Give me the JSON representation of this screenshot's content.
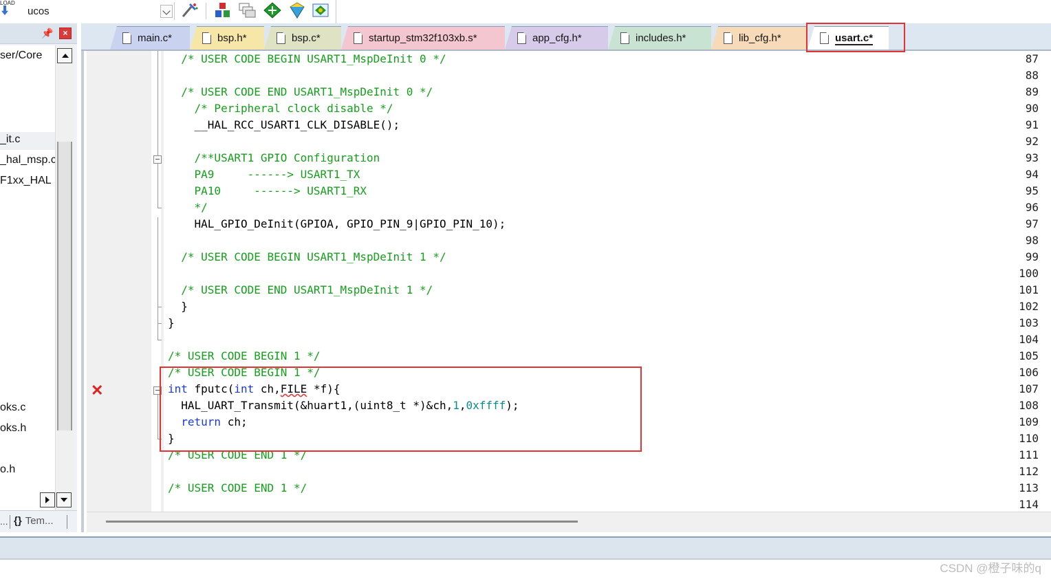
{
  "toolbar": {
    "load_label": "LOAD",
    "target_name": "ucos"
  },
  "left_panel": {
    "tree_items": [
      "ser/Core",
      "_it.c",
      "_hal_msp.c",
      "F1xx_HAL",
      "oks.c",
      "oks.h",
      "o.h"
    ],
    "bottom_tab_1": "...",
    "bottom_tab_2": "{}",
    "bottom_tab_3": "Tem..."
  },
  "tabs": [
    {
      "label": "main.c*",
      "color": "#c9d3f0"
    },
    {
      "label": "bsp.h*",
      "color": "#f6e6a8"
    },
    {
      "label": "bsp.c*",
      "color": "#dfe3c4"
    },
    {
      "label": "startup_stm32f103xb.s*",
      "color": "#f4c6cf"
    },
    {
      "label": "app_cfg.h*",
      "color": "#d6cbe9"
    },
    {
      "label": "includes.h*",
      "color": "#c9e3d3"
    },
    {
      "label": "lib_cfg.h*",
      "color": "#f7dab7"
    },
    {
      "label": "usart.c*",
      "color": "#ffffff",
      "active": true
    }
  ],
  "editor": {
    "lines": [
      {
        "n": "87",
        "t": "  /* USER CODE BEGIN USART1_MspDeInit 0 */"
      },
      {
        "n": "88",
        "t": ""
      },
      {
        "n": "89",
        "t": "  /* USER CODE END USART1_MspDeInit 0 */"
      },
      {
        "n": "90",
        "t": "    /* Peripheral clock disable */"
      },
      {
        "n": "91",
        "t": "    __HAL_RCC_USART1_CLK_DISABLE();"
      },
      {
        "n": "92",
        "t": ""
      },
      {
        "n": "93",
        "t": "    /**USART1 GPIO Configuration"
      },
      {
        "n": "94",
        "t": "    PA9     ------> USART1_TX"
      },
      {
        "n": "95",
        "t": "    PA10     ------> USART1_RX"
      },
      {
        "n": "96",
        "t": "    */"
      },
      {
        "n": "97",
        "t": "    HAL_GPIO_DeInit(GPIOA, GPIO_PIN_9|GPIO_PIN_10);"
      },
      {
        "n": "98",
        "t": ""
      },
      {
        "n": "99",
        "t": "  /* USER CODE BEGIN USART1_MspDeInit 1 */"
      },
      {
        "n": "100",
        "t": ""
      },
      {
        "n": "101",
        "t": "  /* USER CODE END USART1_MspDeInit 1 */"
      },
      {
        "n": "102",
        "t": "  }"
      },
      {
        "n": "103",
        "t": "}"
      },
      {
        "n": "104",
        "t": ""
      },
      {
        "n": "105",
        "t": "/* USER CODE BEGIN 1 */"
      },
      {
        "n": "106",
        "t": "/* USER CODE BEGIN 1 */"
      },
      {
        "n": "107",
        "t": "int fputc(int ch,FILE *f){"
      },
      {
        "n": "108",
        "t": "  HAL_UART_Transmit(&huart1,(uint8_t *)&ch,1,0xffff);"
      },
      {
        "n": "109",
        "t": "  return ch;"
      },
      {
        "n": "110",
        "t": "}"
      },
      {
        "n": "111",
        "t": "/* USER CODE END 1 */"
      },
      {
        "n": "112",
        "t": ""
      },
      {
        "n": "113",
        "t": "/* USER CODE END 1 */"
      },
      {
        "n": "114",
        "t": ""
      }
    ]
  },
  "watermark": "CSDN @橙子味的q"
}
